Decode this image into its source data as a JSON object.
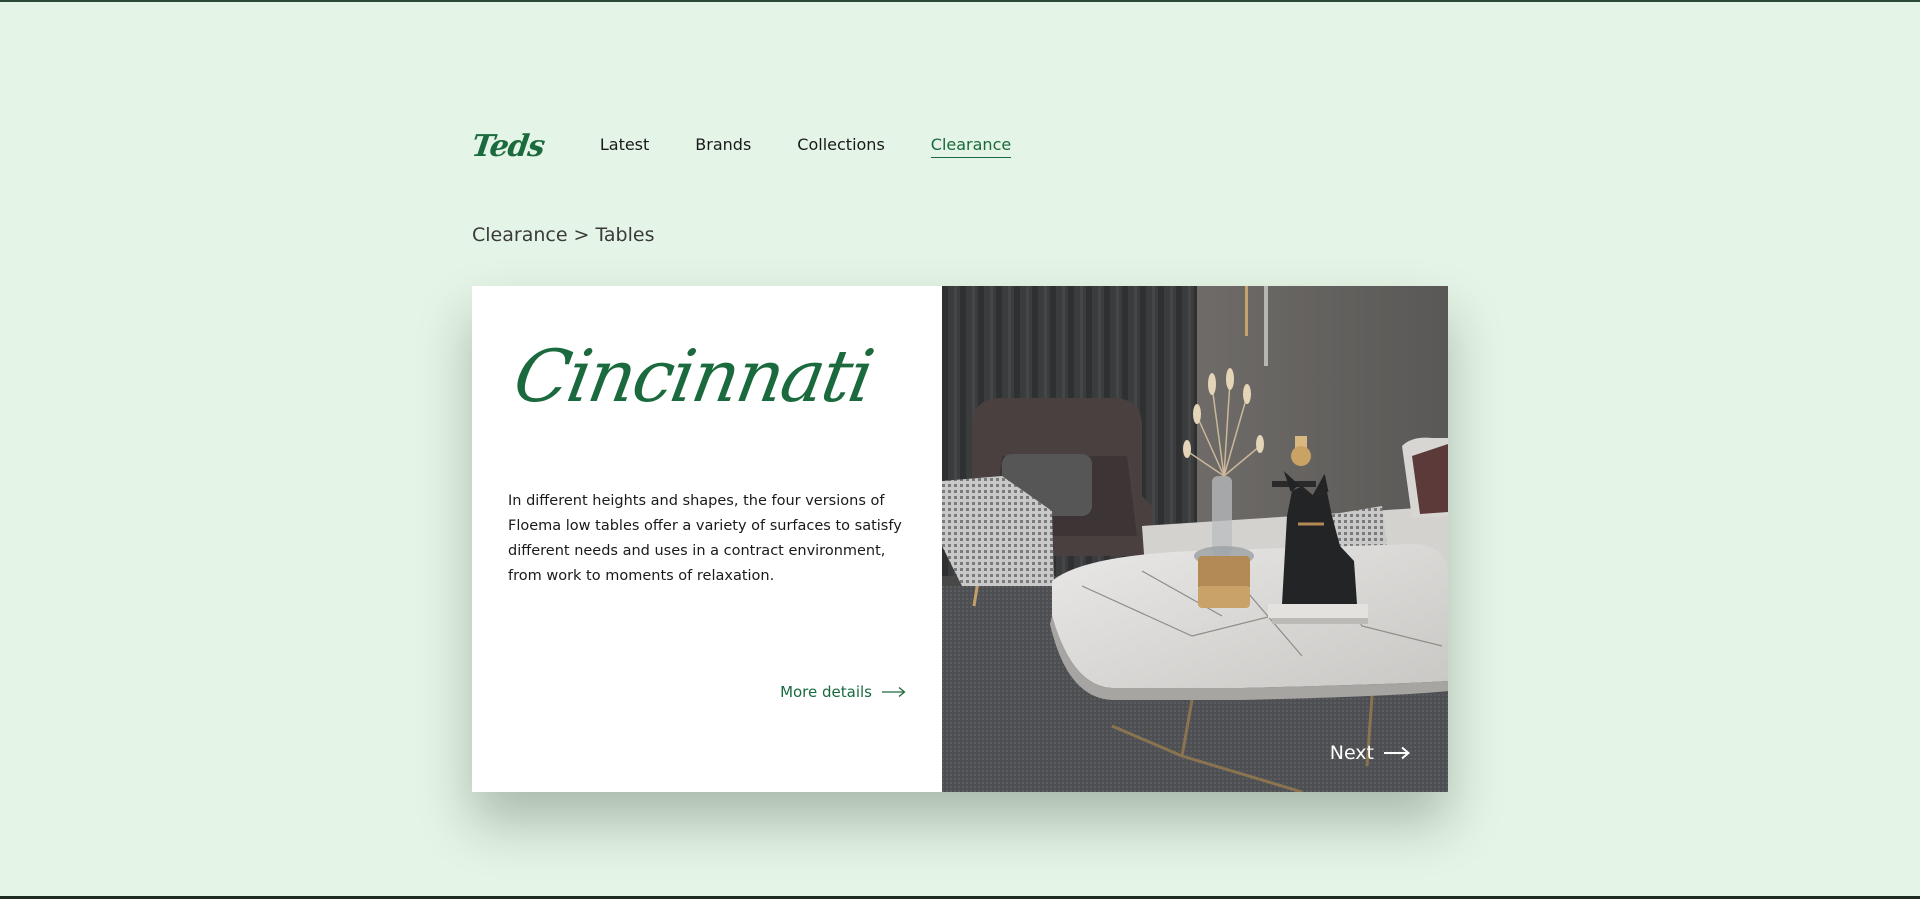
{
  "nav": {
    "logo": "Teds",
    "items": [
      {
        "label": "Latest"
      },
      {
        "label": "Brands"
      },
      {
        "label": "Collections"
      },
      {
        "label": "Clearance"
      }
    ]
  },
  "breadcrumb": {
    "parent": "Clearance",
    "separator": ">",
    "current": "Tables"
  },
  "product": {
    "title": "Cincinnati",
    "description": "In different heights and shapes, the four versions of Floema low tables offer a variety of surfaces to satisfy different needs and uses in a contract environment, from work to moments of relaxation.",
    "more_label": "More details",
    "next_label": "Next"
  },
  "colors": {
    "background": "#e4f4e6",
    "accent": "#1a6a3e",
    "text": "#1a1a1a"
  }
}
